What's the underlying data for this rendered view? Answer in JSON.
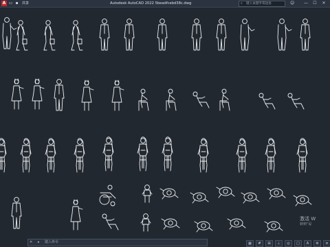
{
  "titlebar": {
    "logo": "A",
    "share_label": "共享",
    "app_title": "Autodesk AutoCAD 2022   5beadfcebd38c.dwg",
    "search_placeholder": "键入关键字或短语",
    "user_icon": "user-icon"
  },
  "window_controls": [
    "—",
    "☐",
    "✕"
  ],
  "command_line": {
    "close_glyph": "✕",
    "prompt": "▸",
    "placeholder": "键入命令"
  },
  "activation_notice": {
    "line1": "激活 W",
    "line2": "转到\"设"
  },
  "colors": {
    "background": "#212830",
    "titlebar": "#2b3340",
    "linework": "#f2f4f6",
    "logo": "#c8242b"
  }
}
